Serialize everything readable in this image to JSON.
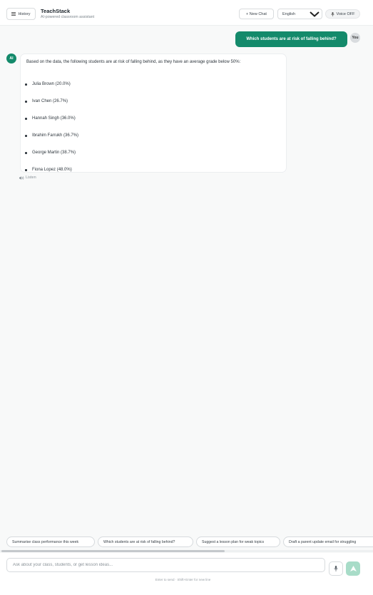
{
  "header": {
    "history_label": "History",
    "app_title": "TeachStack",
    "app_subtitle": "AI-powered classroom assistant",
    "new_chat_label": "+ New Chat",
    "language_value": "English",
    "voice_label": "Voice OFF"
  },
  "conversation": {
    "user_message": "Which students are at risk of falling behind?",
    "user_avatar": "You",
    "ai_avatar": "AI",
    "ai_intro": "Based on the data, the following students are at risk of falling behind, as they have an average grade below 50%:",
    "at_risk_students": [
      "Julia Brown (20.0%)",
      "Ivan Chen (26.7%)",
      "Hannah Singh (36.0%)",
      "Ibrahim Farrukh (36.7%)",
      "George Martin (38.7%)",
      "Fiona Lopez (48.0%)"
    ],
    "listen_label": "Listen"
  },
  "suggestions": [
    "Summarise class performance this week",
    "Which students are at risk of falling behind?",
    "Suggest a lesson plan for weak topics",
    "Draft a parent update email for struggling"
  ],
  "composer": {
    "placeholder": "Ask about your class, students, or get lesson ideas...",
    "hint": "Enter to send · Shift+Enter for new line"
  },
  "icons": {
    "history": "hamburger-icon",
    "language": "chevron-down-icon",
    "voice": "mic-icon",
    "listen": "speaker-icon",
    "mic": "mic-icon",
    "send": "send-icon"
  },
  "colors": {
    "accent": "#148a6b",
    "send_disabled": "#a8dcc8"
  }
}
